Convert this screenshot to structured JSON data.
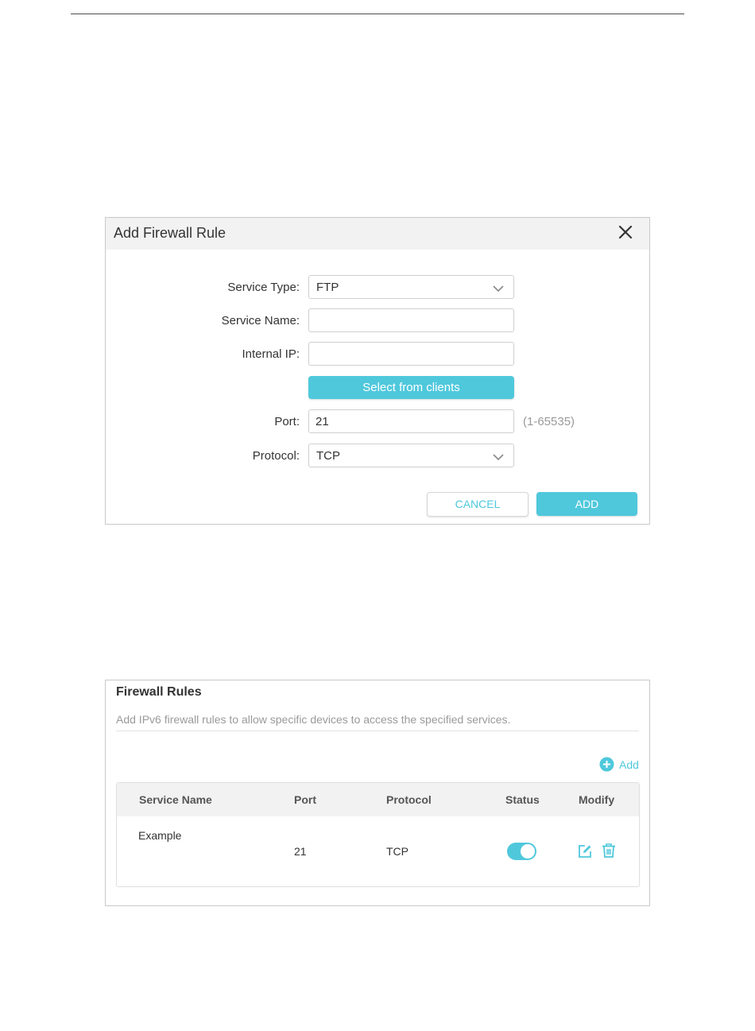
{
  "dialog": {
    "title": "Add Firewall Rule",
    "fields": {
      "service_type": {
        "label": "Service Type:",
        "value": "FTP"
      },
      "service_name": {
        "label": "Service Name:",
        "value": ""
      },
      "internal_ip": {
        "label": "Internal IP:",
        "value": ""
      },
      "select_clients_label": "Select from clients",
      "port": {
        "label": "Port:",
        "value": "21",
        "hint": "(1-65535)"
      },
      "protocol": {
        "label": "Protocol:",
        "value": "TCP"
      }
    },
    "cancel_label": "CANCEL",
    "add_label": "ADD"
  },
  "panel": {
    "title": "Firewall Rules",
    "description": "Add IPv6 firewall rules to allow specific devices to access the specified services.",
    "add_label": "Add",
    "columns": [
      "Service Name",
      "Port",
      "Protocol",
      "Status",
      "Modify"
    ],
    "rows": [
      {
        "service_name": "Example",
        "port": "21",
        "protocol": "TCP",
        "status_enabled": true
      }
    ]
  },
  "colors": {
    "accent": "#4fc8dc",
    "header_bg": "#f2f2f2",
    "hint": "#9a9a9a"
  },
  "icons": [
    "close-icon",
    "chevron-down-icon",
    "plus-circle-icon",
    "edit-icon",
    "trash-icon"
  ]
}
